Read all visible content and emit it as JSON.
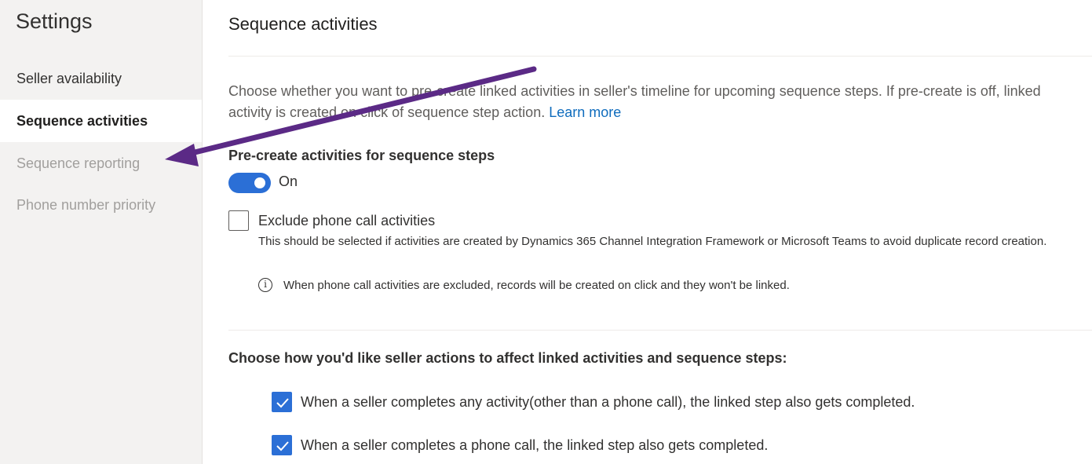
{
  "sidebar": {
    "title": "Settings",
    "items": [
      {
        "label": "Seller availability",
        "state": "normal"
      },
      {
        "label": "Sequence activities",
        "state": "selected"
      },
      {
        "label": "Sequence reporting",
        "state": "disabled"
      },
      {
        "label": "Phone number priority",
        "state": "disabled"
      }
    ]
  },
  "main": {
    "title": "Sequence activities",
    "description": "Choose whether you want to pre-create linked activities in seller's timeline for upcoming sequence steps. If pre-create is off, linked activity is created on click of sequence step action.",
    "learn_more": "Learn more",
    "precreate": {
      "label": "Pre-create activities for sequence steps",
      "toggle_state": "On",
      "toggle_on": true
    },
    "exclude_phone": {
      "label": "Exclude phone call activities",
      "checked": false,
      "helper": "This should be selected if activities are created by Dynamics 365 Channel Integration Framework or Microsoft Teams to avoid duplicate record creation.",
      "info": "When phone call activities are excluded, records will be created on click and they won't be linked.",
      "info_icon": "info-icon"
    },
    "seller_actions": {
      "label": "Choose how you'd like seller actions to affect linked activities and sequence steps:",
      "options": [
        {
          "label": "When a seller completes any activity(other than a phone call), the linked step also gets completed.",
          "checked": true
        },
        {
          "label": "When a seller completes a phone call, the linked step also gets completed.",
          "checked": true
        }
      ]
    }
  },
  "annotation": {
    "type": "arrow",
    "color": "#5b2a86"
  },
  "colors": {
    "accent": "#2b6fd6",
    "link": "#0f6cbd",
    "sidebar_bg": "#f3f2f1",
    "disabled_text": "#a19f9d"
  }
}
